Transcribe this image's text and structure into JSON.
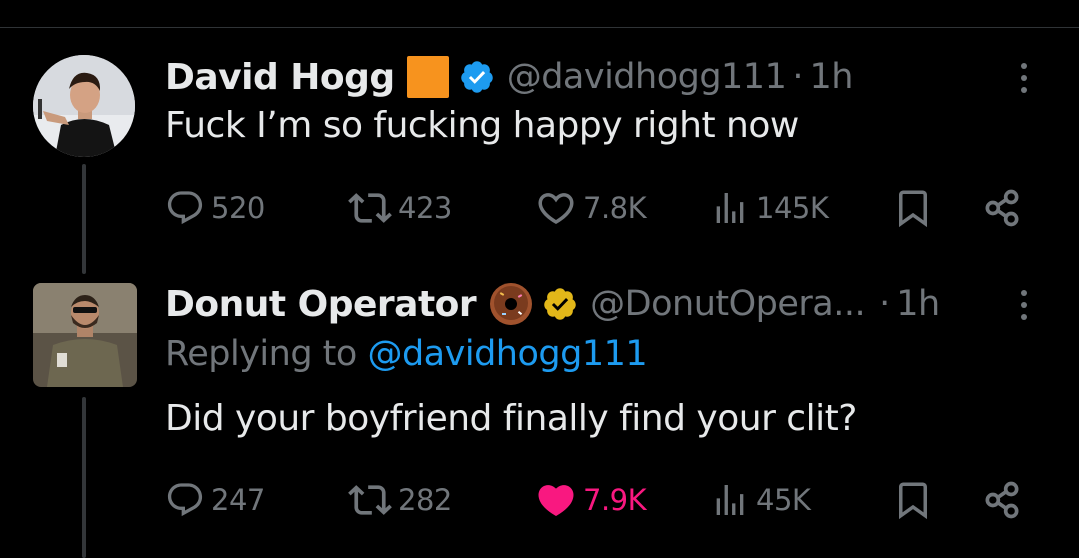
{
  "colors": {
    "background": "#000000",
    "text": "#e7e9ea",
    "muted": "#71767b",
    "link": "#1d9bf0",
    "liked": "#f91880",
    "verified_blue": "#1d9bf0",
    "verified_gold": "#e2b719",
    "emoji_orange_square": "#f7931e"
  },
  "tweets": [
    {
      "avatar_icon": "david-hogg-avatar",
      "name": "David Hogg",
      "name_badge_icon": "orange-square-emoji",
      "verified_icon": "blue-verified-badge-icon",
      "handle": "@davidhogg111",
      "separator": "·",
      "time": "1h",
      "text": "Fuck I’m so fucking happy right now",
      "stats": {
        "replies": "520",
        "reposts": "423",
        "likes": "7.8K",
        "views": "145K"
      },
      "liked": false
    },
    {
      "avatar_icon": "donut-operator-avatar",
      "name": "Donut Operator",
      "name_badge_icon": "donut-emoji",
      "verified_icon": "gold-verified-badge-icon",
      "handle": "@DonutOpera...",
      "separator": "·",
      "time": "1h",
      "replying_label": "Replying to",
      "replying_handle": "@davidhogg111",
      "text": "Did your boyfriend finally find your clit?",
      "stats": {
        "replies": "247",
        "reposts": "282",
        "likes": "7.9K",
        "views": "45K"
      },
      "liked": true
    }
  ]
}
